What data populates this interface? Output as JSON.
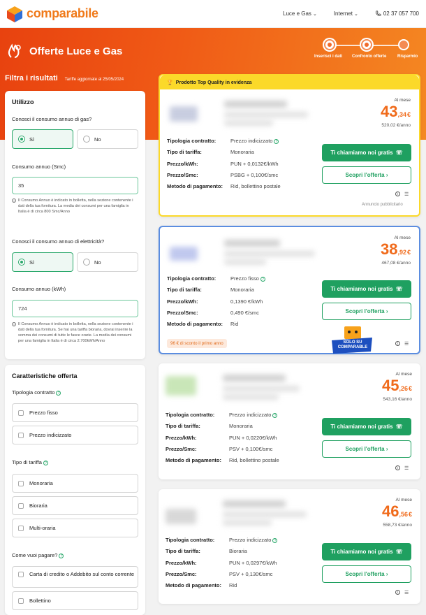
{
  "brand": {
    "name": "comparabile"
  },
  "nav": {
    "items": [
      "Luce e Gas",
      "Internet"
    ],
    "phone": "02 37 057 700"
  },
  "hero": {
    "title": "Offerte Luce e Gas",
    "steps": [
      "Inserisci i dati",
      "Confronto offerte",
      "Risparmio"
    ]
  },
  "filters": {
    "title": "Filtra i risultati",
    "updated": "Tariffe aggiornate al 25/05/2024"
  },
  "usage": {
    "title": "Utilizzo",
    "gas_question": "Conosci il consumo annuo di gas?",
    "yes": "Sì",
    "no": "No",
    "gas_label": "Consumo annuo (Smc)",
    "gas_value": "35",
    "gas_note": "Il Consumo Annuo è indicato in bolletta, nella sezione contenente i dati della tua fornitura. La media dei consumi per una famiglia in Italia è di circa 800 Smc/Anno",
    "el_question": "Conosci il consumo annuo di elettricità?",
    "el_label": "Consumo annuo (kWh)",
    "el_value": "724",
    "el_note": "Il Consumo Annuo è indicato in bolletta, nella sezione contenente i dati della tua fornitura. Se hai una tariffa bioraria, dovrai inserire la somma dei consumi di tutte le fasce orarie. La media dei consumi per una famiglia in Italia è di circa 2.700kWh/Anno"
  },
  "features": {
    "title": "Caratteristiche offerta",
    "contract_label": "Tipologia contratto",
    "contract_options": [
      "Prezzo fisso",
      "Prezzo indicizzato"
    ],
    "tariff_label": "Tipo di tariffa",
    "tariff_options": [
      "Monoraria",
      "Bioraria",
      "Multi-oraria"
    ],
    "pay_label": "Come vuoi pagare?",
    "pay_options": [
      "Carta di credito o Addebito sul conto corrente",
      "Bollettino"
    ]
  },
  "spec_labels": {
    "k1": "Tipologia contratto:",
    "k2": "Tipo di tariffa:",
    "k3": "Prezzo/kWh:",
    "k4": "Prezzo/Smc:",
    "k5": "Metodo di pagamento:"
  },
  "labels": {
    "per_month": "Al mese",
    "call": "Ti chiamiamo noi gratis",
    "discover": "Scopri l'offerta",
    "featured": "Prodotto Top Quality in evidenza",
    "ad": "Annuncio pubblicitario",
    "exclusive": "SOLO SU COMPARABLE"
  },
  "offers": [
    {
      "price_int": "43",
      "price_dec": ",34",
      "currency": "€",
      "year": "520,02 €/anno",
      "contract": "Prezzo indicizzato",
      "tariff": "Monoraria",
      "kwh": "PUN + 0,0132€/kWh",
      "smc": "PSBG + 0,100€/smc",
      "payment": "Rid, bollettino postale"
    },
    {
      "price_int": "38",
      "price_dec": ",92",
      "currency": "€",
      "year": "467,08 €/anno",
      "contract": "Prezzo fisso",
      "tariff": "Monoraria",
      "kwh": "0,1390 €/kWh",
      "smc": "0,490 €/smc",
      "payment": "Rid",
      "discount": "96 € di sconto il primo anno"
    },
    {
      "price_int": "45",
      "price_dec": ",26",
      "currency": "€",
      "year": "543,16 €/anno",
      "contract": "Prezzo indicizzato",
      "tariff": "Monoraria",
      "kwh": "PUN + 0,0220€/kWh",
      "smc": "PSV + 0,100€/smc",
      "payment": "Rid, bollettino postale"
    },
    {
      "price_int": "46",
      "price_dec": ",56",
      "currency": "€",
      "year": "558,73 €/anno",
      "contract": "Prezzo indicizzato",
      "tariff": "Bioraria",
      "kwh": "PUN + 0,0297€/kWh",
      "smc": "PSV + 0,130€/smc",
      "payment": "Rid"
    }
  ],
  "colors": {
    "brand": "#f07a1a",
    "green": "#1fa060",
    "featured": "#fbd92a",
    "highlight": "#5b8de0"
  }
}
